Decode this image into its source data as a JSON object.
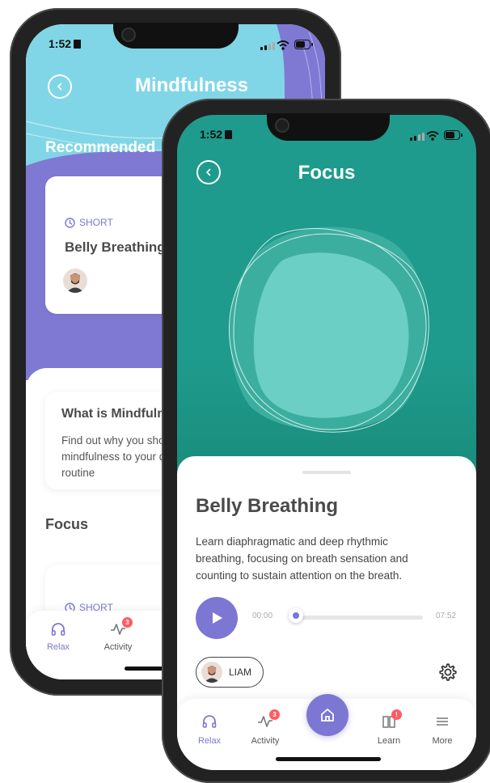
{
  "back_screen": {
    "status_time": "1:52",
    "title": "Mindfulness",
    "recommended_heading": "Recommended",
    "rec_card": {
      "tag": "SHORT",
      "title": "Belly Breathing"
    },
    "what_card": {
      "title": "What is Mindfulness",
      "body_lines": [
        "Find out why you should add",
        "mindfulness to your daily",
        "routine"
      ]
    },
    "focus_heading": "Focus",
    "focus_card": {
      "tag": "SHORT"
    },
    "nav": {
      "relax": "Relax",
      "activity": "Activity",
      "activity_badge": "3"
    }
  },
  "front_screen": {
    "status_time": "1:52",
    "title": "Focus",
    "sheet": {
      "title": "Belly Breathing",
      "description_lines": [
        "Learn diaphragmatic and deep rhythmic",
        "breathing, focusing on breath sensation and",
        "counting to sustain attention on the breath."
      ],
      "time_current": "00:00",
      "time_total": "07:52",
      "progress": 0.0,
      "narrator": "LIAM"
    },
    "nav": {
      "relax": "Relax",
      "activity": "Activity",
      "activity_badge": "3",
      "learn": "Learn",
      "learn_badge": "!",
      "more": "More"
    }
  },
  "colors": {
    "accent": "#7c77d3",
    "teal": "#1e9b8c",
    "sky": "#7fd8e8",
    "purple": "#8078d4"
  }
}
